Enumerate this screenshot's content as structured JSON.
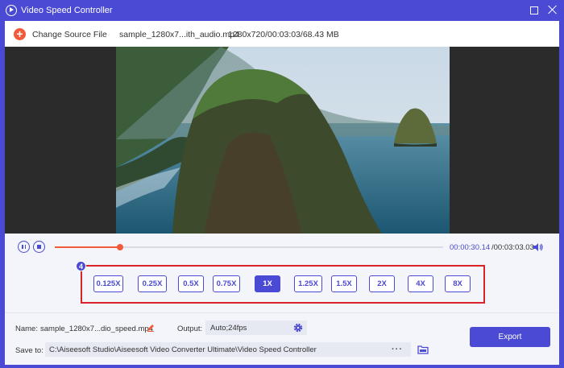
{
  "window": {
    "title": "Video Speed Controller"
  },
  "source": {
    "change_label": "Change Source File",
    "file_name": "sample_1280x7...ith_audio.mp4",
    "file_info": "1280x720/00:03:03/68.43 MB"
  },
  "player": {
    "current_time": "00:00:30.14",
    "total_time": "/00:03:03.03",
    "progress": 0.168
  },
  "speed": {
    "badge": "4",
    "options": [
      "0.125X",
      "0.25X",
      "0.5X",
      "0.75X",
      "1X",
      "1.25X",
      "1.5X",
      "2X",
      "4X",
      "8X"
    ],
    "selected": "1X"
  },
  "output": {
    "name_label": "Name:",
    "name_value": "sample_1280x7...dio_speed.mp4",
    "output_label": "Output:",
    "output_value": "Auto;24fps",
    "save_label": "Save to:",
    "save_path": "C:\\Aiseesoft Studio\\Aiseesoft Video Converter Ultimate\\Video Speed Controller",
    "more": "···",
    "export_label": "Export"
  },
  "colors": {
    "accent": "#4a4ad4",
    "highlight": "#d9222a",
    "progress": "#f25a3a"
  }
}
